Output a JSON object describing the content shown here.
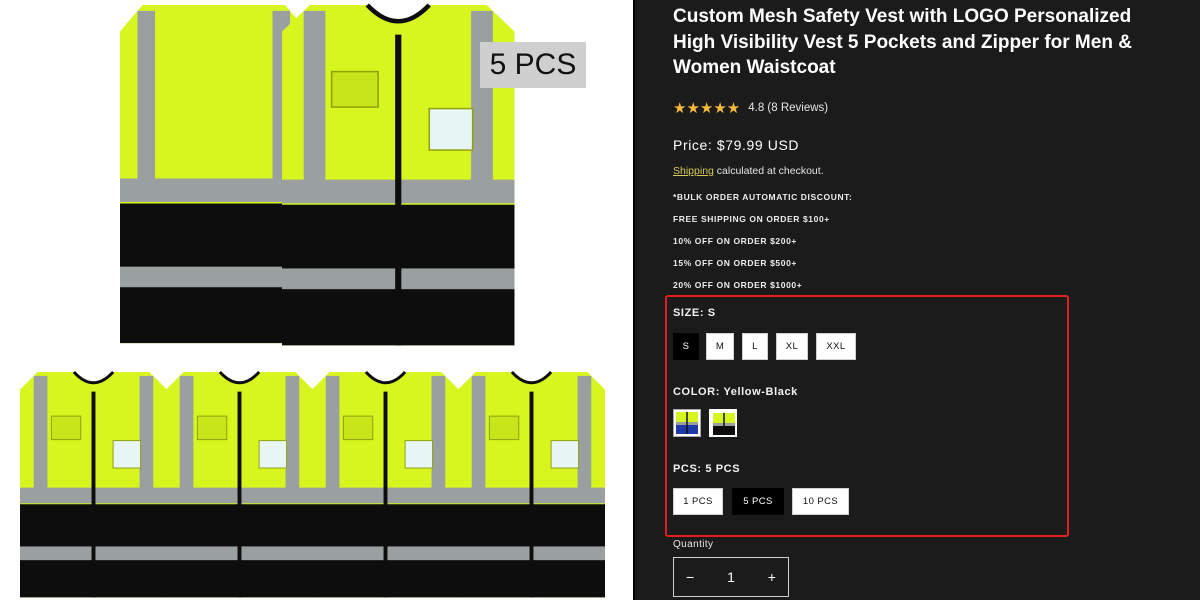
{
  "gallery": {
    "badge_text": "5 PCS"
  },
  "product": {
    "title": "Custom Mesh Safety Vest with LOGO Personalized High Visibility Vest 5 Pockets and Zipper for Men & Women Waistcoat",
    "rating_value": 4.8,
    "stars": "★★★★★",
    "rating_text": "4.8 (8 Reviews)",
    "price": "Price: $79.99 USD",
    "shipping_link": "Shipping",
    "shipping_rest": " calculated at checkout.",
    "bulk": [
      "*BULK ORDER AUTOMATIC DISCOUNT:",
      "FREE SHIPPING ON ORDER $100+",
      "10% OFF ON ORDER $200+",
      "15% OFF ON ORDER $500+",
      "20% OFF ON ORDER $1000+"
    ]
  },
  "variants": {
    "size_label": "SIZE: S",
    "sizes": [
      "S",
      "M",
      "L",
      "XL",
      "XXL"
    ],
    "selected_size": "S",
    "color_label": "COLOR: Yellow-Black",
    "colors": [
      "Yellow-Blue",
      "Yellow-Black"
    ],
    "selected_color": "Yellow-Black",
    "pcs_label": "PCS: 5 PCS",
    "pcs": [
      "1 PCS",
      "5 PCS",
      "10 PCS"
    ],
    "selected_pcs": "5 PCS"
  },
  "quantity": {
    "label": "Quantity",
    "value": "1",
    "minus": "−",
    "plus": "+"
  },
  "colors": {
    "vest_yellow": "#d7f51f",
    "vest_black": "#0d0d0d",
    "reflective": "#9aa0a0",
    "highlight_red": "#e02020",
    "star_gold": "#f5b93a"
  }
}
